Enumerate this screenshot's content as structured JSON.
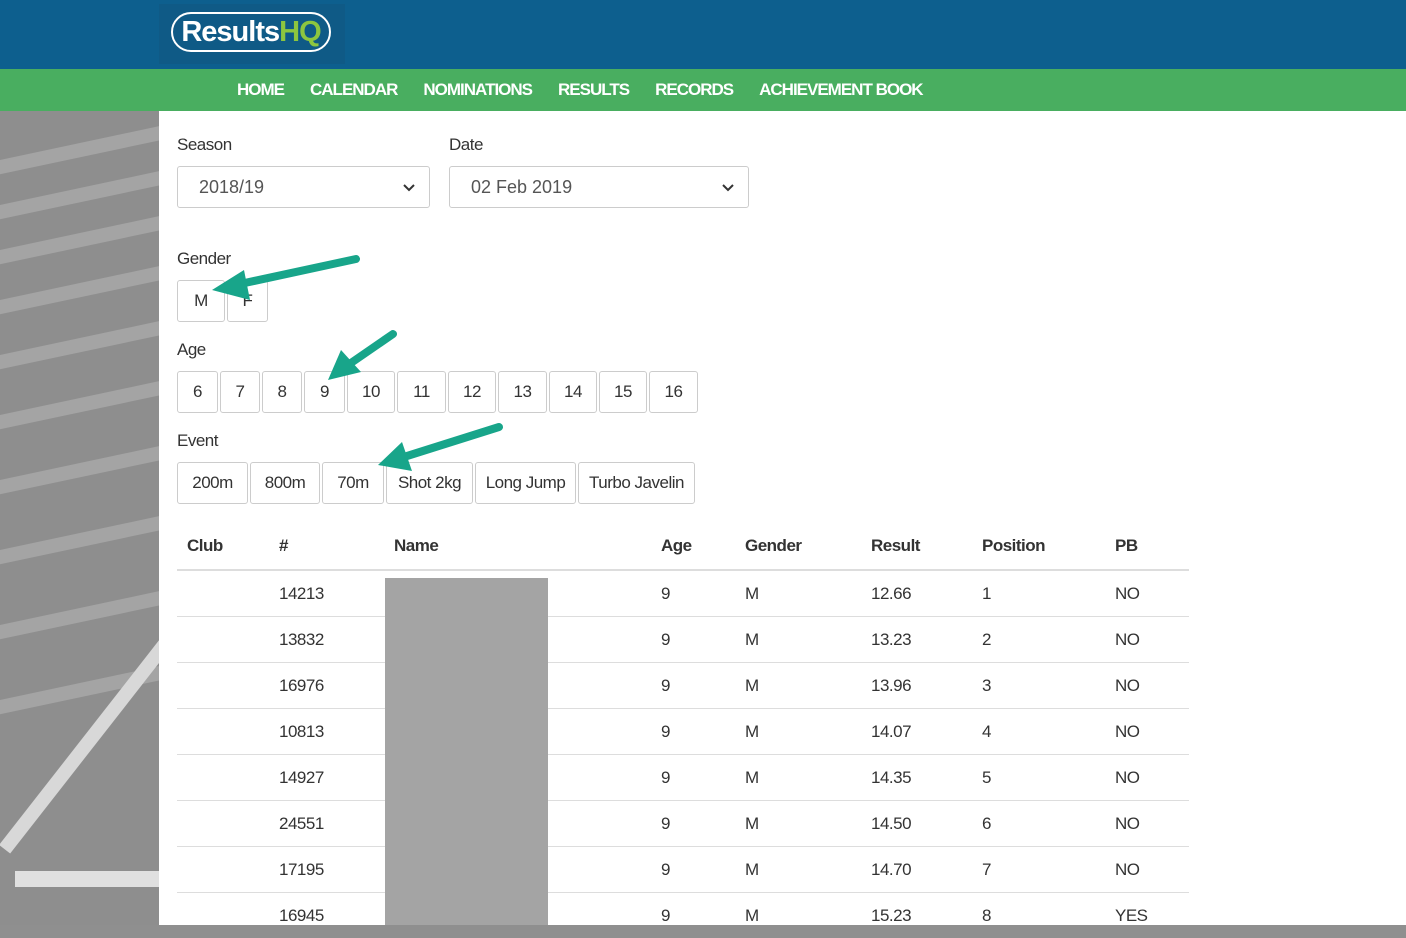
{
  "header": {
    "logo_text_main": "Results",
    "logo_text_accent": "HQ",
    "colors": {
      "topbar": "#0d5f8e",
      "navbar": "#49ae60",
      "accent": "#8dc63f",
      "arrow": "#18a58a"
    }
  },
  "nav": [
    {
      "label": "HOME"
    },
    {
      "label": "CALENDAR"
    },
    {
      "label": "NOMINATIONS"
    },
    {
      "label": "RESULTS"
    },
    {
      "label": "RECORDS"
    },
    {
      "label": "ACHIEVEMENT BOOK"
    }
  ],
  "filters": {
    "season": {
      "label": "Season",
      "value": "2018/19",
      "icon": "chevron-down-icon"
    },
    "date": {
      "label": "Date",
      "value": "02 Feb 2019",
      "icon": "chevron-down-icon"
    },
    "gender": {
      "label": "Gender",
      "options": [
        "M",
        "F"
      ]
    },
    "age": {
      "label": "Age",
      "options": [
        "6",
        "7",
        "8",
        "9",
        "10",
        "11",
        "12",
        "13",
        "14",
        "15",
        "16"
      ]
    },
    "event": {
      "label": "Event",
      "options": [
        "200m",
        "800m",
        "70m",
        "Shot 2kg",
        "Long Jump",
        "Turbo Javelin"
      ]
    }
  },
  "table": {
    "columns": [
      "Club",
      "#",
      "Name",
      "Age",
      "Gender",
      "Result",
      "Position",
      "PB"
    ],
    "rows": [
      {
        "club": "",
        "num": "14213",
        "name": "",
        "age": "9",
        "gender": "M",
        "result": "12.66",
        "position": "1",
        "pb": "NO"
      },
      {
        "club": "",
        "num": "13832",
        "name": "",
        "age": "9",
        "gender": "M",
        "result": "13.23",
        "position": "2",
        "pb": "NO"
      },
      {
        "club": "",
        "num": "16976",
        "name": "",
        "age": "9",
        "gender": "M",
        "result": "13.96",
        "position": "3",
        "pb": "NO"
      },
      {
        "club": "",
        "num": "10813",
        "name": "",
        "age": "9",
        "gender": "M",
        "result": "14.07",
        "position": "4",
        "pb": "NO"
      },
      {
        "club": "",
        "num": "14927",
        "name": "",
        "age": "9",
        "gender": "M",
        "result": "14.35",
        "position": "5",
        "pb": "NO"
      },
      {
        "club": "",
        "num": "24551",
        "name": "",
        "age": "9",
        "gender": "M",
        "result": "14.50",
        "position": "6",
        "pb": "NO"
      },
      {
        "club": "",
        "num": "17195",
        "name": "",
        "age": "9",
        "gender": "M",
        "result": "14.70",
        "position": "7",
        "pb": "NO"
      },
      {
        "club": "",
        "num": "16945",
        "name": "",
        "age": "9",
        "gender": "M",
        "result": "15.23",
        "position": "8",
        "pb": "YES"
      }
    ]
  }
}
